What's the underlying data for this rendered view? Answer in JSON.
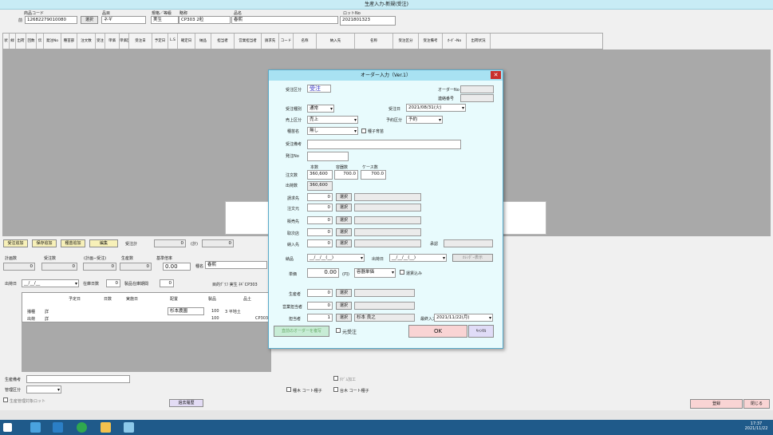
{
  "window": {
    "title": "生産入力-新規(受注)"
  },
  "header": {
    "product_code_label": "商品コード",
    "product_code_prefix": "前",
    "product_code_value": "12682279010080",
    "select_label": "選択",
    "variety_label": "品目",
    "variety_value": "ネギ",
    "grade_label": "規格／等級",
    "grade_value": "実生",
    "spec_label": "略称",
    "spec_value": "CP303 2粒",
    "name_label": "品名",
    "name_value": "春煕",
    "lot_label": "ロットNo",
    "lot_value": "2021801323"
  },
  "grid": {
    "columns": [
      "状",
      "緑",
      "出荷",
      "回数",
      "伝",
      "発注No",
      "種苗部",
      "注文数",
      "受注",
      "単価",
      "単価区分",
      "受注日",
      "予定日",
      "L.S",
      "確定日",
      "納品",
      "担当者",
      "営業担当者",
      "請求先",
      "コード",
      "名称",
      "納入先",
      "名称",
      "受注区分",
      "受注備考",
      "ｵｰﾀﾞｰNo",
      "出荷状況"
    ]
  },
  "bottom": {
    "add_order_btn": "受注追加",
    "add_stock_btn": "保存追加",
    "add_sample_btn": "種苗追加",
    "edit_btn": "編集",
    "order_count_label": "受注計",
    "order_count_value": "0",
    "total_label": "(計)",
    "total_value": "0",
    "plan_label": "計画数",
    "plan_value": "0",
    "order_label": "受注数",
    "order_value": "0",
    "plan_diff_label": "(計画−受注)",
    "plan_diff_value": "0",
    "production_label": "生産数",
    "production_value": "0",
    "base_rate_label": "基準倍率",
    "base_rate_value": "0.00",
    "variety2_label": "種名",
    "variety2_value": "春煕",
    "ship_label": "出荷日",
    "ship_value": "__/__/__",
    "stock_days_label": "在庫日数",
    "stock_days_value": "0",
    "prod_stock_label": "製品在庫期間",
    "prod_stock_value": "0",
    "lot_info": "目的ｸﾞﾗﾌ 実生 ﾈｷﾞCP303",
    "sub_headers": [
      "予定日",
      "日数",
      "実施日",
      "配置",
      "製品",
      "粒",
      "品土"
    ],
    "row1": {
      "label": "播種",
      "mark": "詳",
      "place": "杉本農園",
      "num": "100",
      "note": "3 平地土"
    },
    "row2": {
      "label": "出荷",
      "mark": "詳",
      "num": "100",
      "note": "CP303"
    },
    "producer_note_label": "生産備考",
    "division_label": "管理区分",
    "checkbox_label": "ﾀﾃﾞﾑ加工",
    "chk1_label": "種木 コート種子",
    "chk2_label": "台木 コート種子",
    "lot_manage_label": "生産管理対象ロット",
    "history_btn": "過去履歴",
    "save_btn": "登録",
    "close_btn": "閉じる"
  },
  "dialog": {
    "title": "オーダー入力（Ver.1）",
    "type_label": "受注区分",
    "type_value": "受注",
    "order_no_label": "オーダーNo",
    "delivery_no_label": "連絡番号",
    "order_type_label": "受注種別",
    "order_type_value": "通常",
    "date_label": "受注日",
    "date_value": "2021/08/31(火)",
    "sales_label": "売上区分",
    "sales_value": "売上",
    "reserve_label": "予約区分",
    "reserve_value": "予約",
    "seedling_label": "種苗名",
    "seedling_value": "無し",
    "seedling_check_label": "種子育苗",
    "order_note_label": "受注備考",
    "po_label": "発注No",
    "qty_head_label": "本数",
    "cont_head_label": "容器数",
    "case_head_label": "ケース数",
    "order_qty_label": "注文数",
    "order_qty_value": "360,600",
    "order_cont_value": "700.0",
    "order_case_value": "700.0",
    "ship_qty_label": "出荷数",
    "ship_qty_value": "360,600",
    "bill_label": "請求先",
    "orderer_label": "注文元",
    "sales_to_label": "販売先",
    "handler_label": "取次店",
    "deliver_label": "納入先",
    "zero": "0",
    "select_label": "選択",
    "approve_label": "承認",
    "deliver_date_label": "納品",
    "deliver_date_value": "__/__/__(__)",
    "ship_date_label": "出荷日",
    "ship_date_value": "__/__/__(__)",
    "calendar_btn": "ｶﾚﾝﾀﾞｰ表示",
    "price_label": "単価",
    "price_value": "0.00",
    "price_unit": "(円)",
    "price_kind_value": "容器単価",
    "shipping_incl_label": "運賃込み",
    "producer_label": "生産者",
    "sales_rep_label": "営業担当者",
    "person_label": "担当者",
    "person_code": "1",
    "person_name": "杉本 良之",
    "last_input_label": "最終入力",
    "last_input_value": "2021/11/22(月)",
    "prev_btn": "直前のオーダーを複写",
    "original_label": "元受注",
    "ok_btn": "OK",
    "cancel_btn": "ｷｬﾝｾﾙ"
  },
  "taskbar": {
    "time": "17:37",
    "date": "2021/11/22"
  }
}
